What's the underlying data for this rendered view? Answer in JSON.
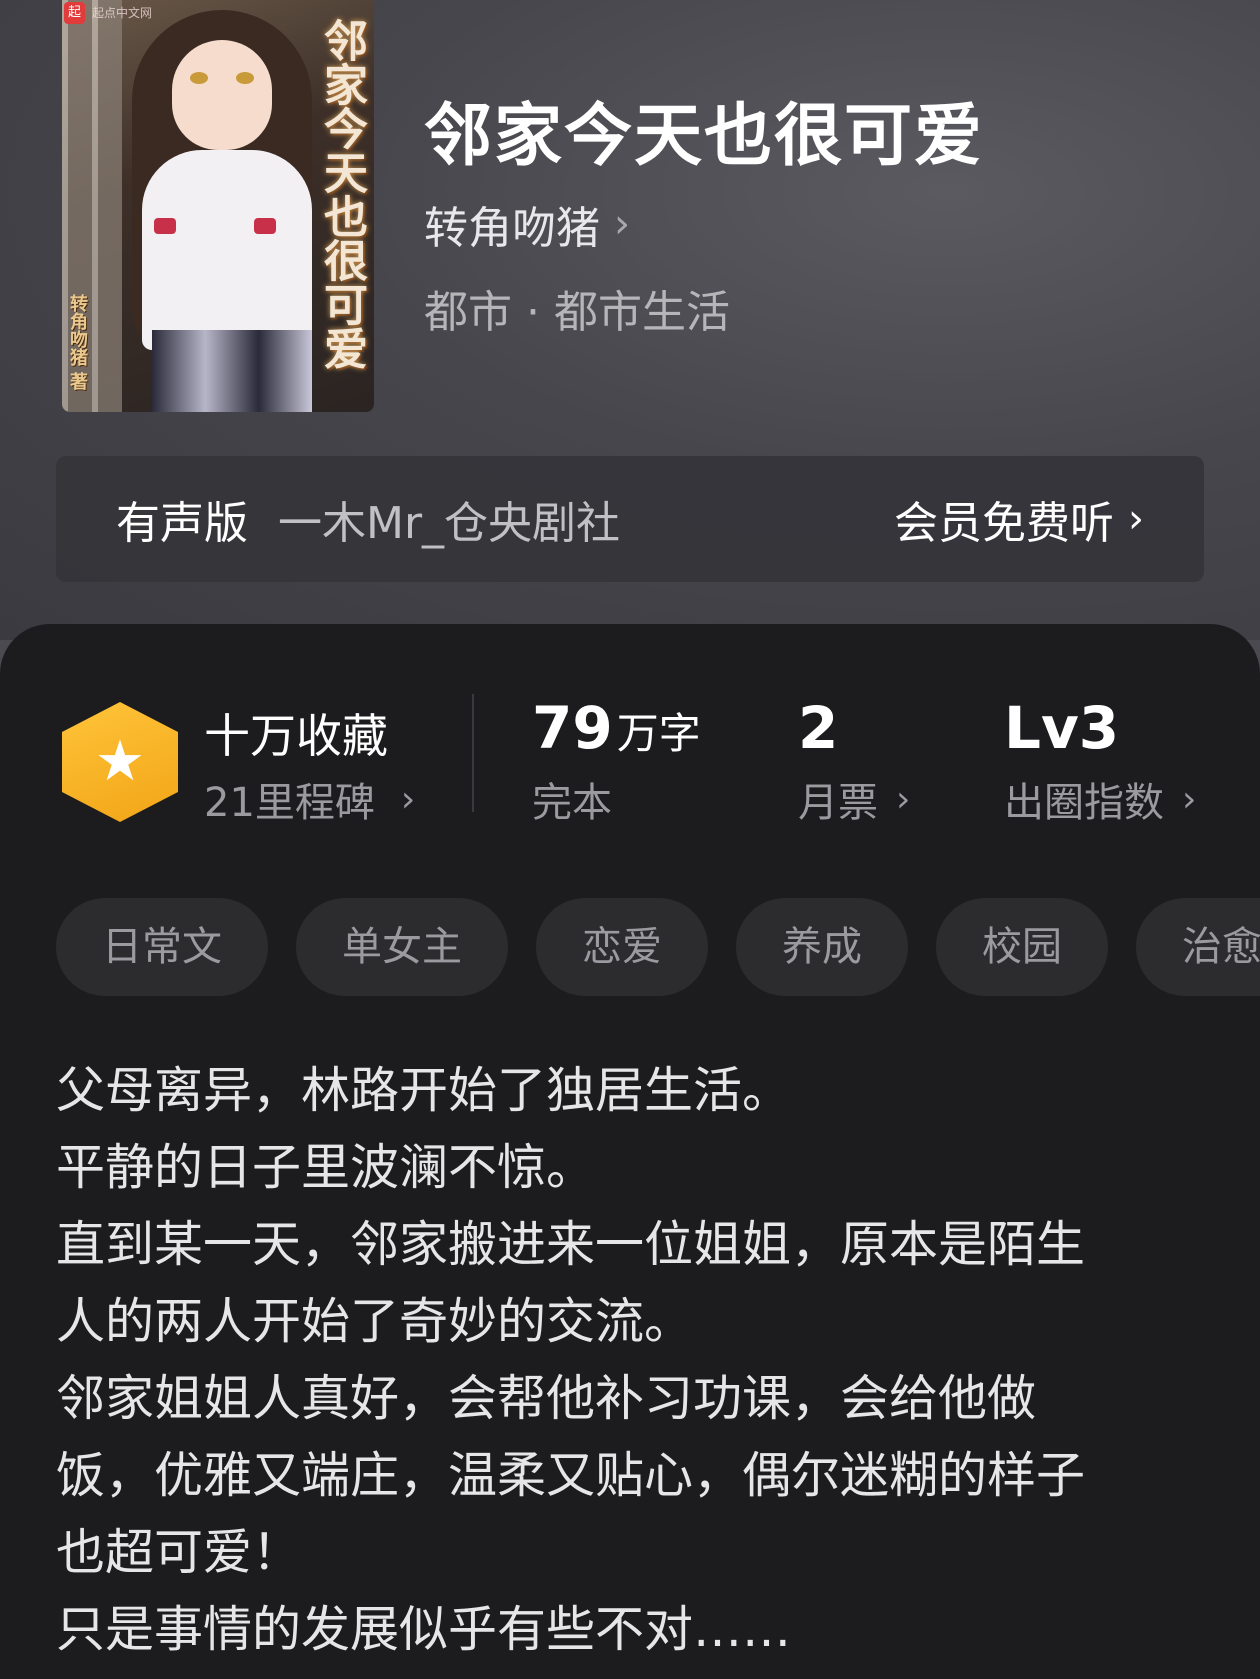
{
  "cover": {
    "badge": "起",
    "badge_site": "起点中文网",
    "title": "邻家今天也很可爱",
    "author": "转角吻猪 著"
  },
  "book": {
    "title": "邻家今天也很可爱",
    "author": "转角吻猪",
    "genre": "都市 · 都市生活"
  },
  "audio": {
    "label": "有声版",
    "narrator": "一木Mr_仓央剧社",
    "action": "会员免费听"
  },
  "stats": {
    "milestone_title": "十万收藏",
    "milestone_sub": "21里程碑",
    "words_value": "79",
    "words_unit": "万字",
    "words_label": "完本",
    "tickets_value": "2",
    "tickets_label": "月票",
    "level_value": "Lv3",
    "level_label": "出圈指数"
  },
  "tags": [
    "日常文",
    "单女主",
    "恋爱",
    "养成",
    "校园",
    "治愈"
  ],
  "synopsis": [
    "父母离异，林路开始了独居生活。",
    "平静的日子里波澜不惊。",
    "直到某一天，邻家搬进来一位姐姐，原本是陌生",
    "人的两人开始了奇妙的交流。",
    "邻家姐姐人真好，会帮他补习功课，会给他做",
    "饭，优雅又端庄，温柔又贴心，偶尔迷糊的样子",
    "也超可爱！",
    "只是事情的发展似乎有些不对……"
  ],
  "icons": {
    "chevron": "›",
    "star": "★"
  },
  "colors": {
    "accent_gold": "#f2a516",
    "panel_bg": "#1c1c1e",
    "tag_bg": "#2c2c2f"
  }
}
